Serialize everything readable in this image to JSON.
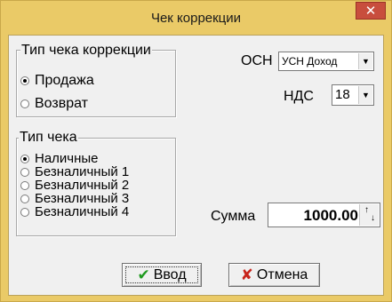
{
  "window": {
    "title": "Чек коррекции"
  },
  "correction_type": {
    "legend": "Тип чека коррекции",
    "options": [
      "Продажа",
      "Возврат"
    ],
    "selected_index": 0
  },
  "receipt_type": {
    "legend": "Тип чека",
    "options": [
      "Наличные",
      "Безналичный 1",
      "Безналичный 2",
      "Безналичный 3",
      "Безналичный 4"
    ],
    "selected_index": 0
  },
  "tax_system": {
    "label": "ОСН",
    "value": "УСН Доход"
  },
  "vat": {
    "label": "НДС",
    "value": "18"
  },
  "amount": {
    "label": "Сумма",
    "value": "1000.00"
  },
  "buttons": {
    "ok_label": "Ввод",
    "cancel_label": "Отмена"
  },
  "icons": {
    "close": "close-icon",
    "check": "check-icon",
    "cross": "cross-icon",
    "dropdown": "chevron-down-icon",
    "spin": "spin-arrows-icon"
  },
  "colors": {
    "titlebar": "#eaca67",
    "close_button": "#c84e3d",
    "check_icon": "#1f9a1f",
    "cross_icon": "#c8241b"
  }
}
